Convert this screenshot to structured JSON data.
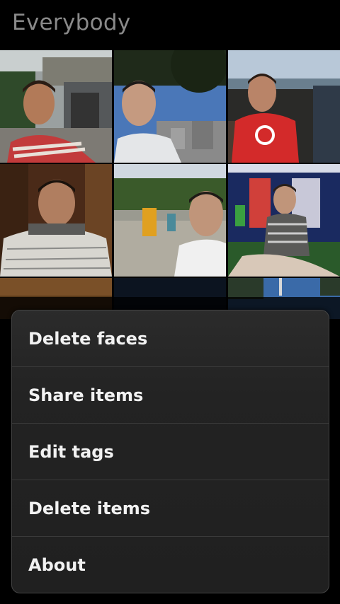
{
  "header": {
    "title": "Everybody"
  },
  "grid": {
    "thumbnails": [
      {
        "name": "photo-thumbnail-1"
      },
      {
        "name": "photo-thumbnail-2"
      },
      {
        "name": "photo-thumbnail-3"
      },
      {
        "name": "photo-thumbnail-4"
      },
      {
        "name": "photo-thumbnail-5"
      },
      {
        "name": "photo-thumbnail-6"
      }
    ]
  },
  "menu": {
    "items": [
      {
        "label": "Delete faces"
      },
      {
        "label": "Share items"
      },
      {
        "label": "Edit tags"
      },
      {
        "label": "Delete items"
      },
      {
        "label": "About"
      }
    ]
  }
}
